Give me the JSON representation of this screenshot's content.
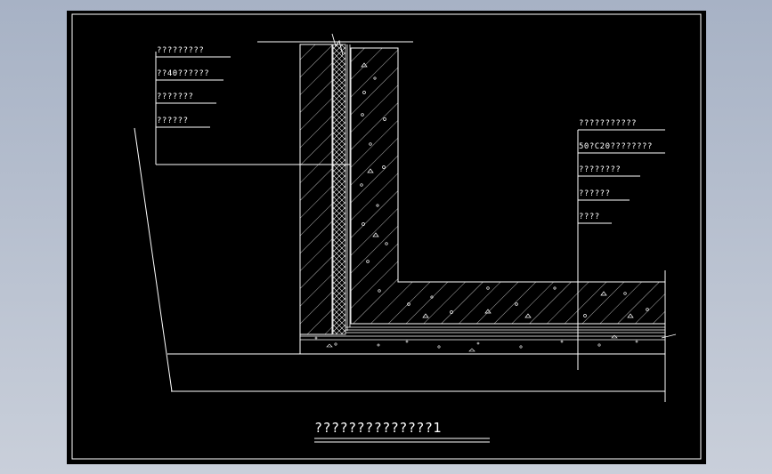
{
  "drawing": {
    "title": "??????????????1",
    "left_callouts": [
      "?????????",
      "??40??????",
      "???????",
      "??????"
    ],
    "right_callouts": [
      "???????????",
      "50?C20????????",
      "????????",
      "??????",
      "????"
    ]
  },
  "colors": {
    "sheet": "#000000",
    "linework": "#ffffff",
    "background_top": "#a7b2c5",
    "background_bottom": "#c9cfda"
  }
}
